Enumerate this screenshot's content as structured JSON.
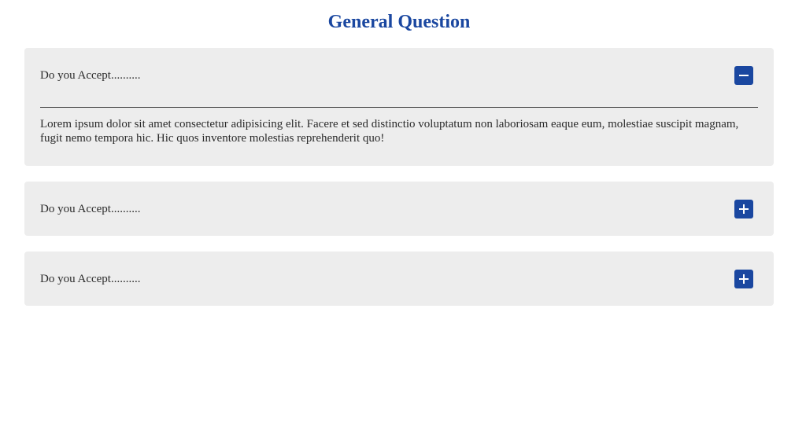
{
  "page": {
    "title": "General Question"
  },
  "colors": {
    "accent": "#1a47a0",
    "card_bg": "#ededed",
    "text": "#2b2b2b"
  },
  "faq": {
    "items": [
      {
        "question": "Do you Accept..........",
        "expanded": true,
        "toggle_icon": "minus-icon",
        "answer": "Lorem ipsum dolor sit amet consectetur adipisicing elit. Facere et sed distinctio voluptatum non laboriosam eaque eum, molestiae suscipit magnam, fugit nemo tempora hic. Hic quos inventore molestias reprehenderit quo!"
      },
      {
        "question": "Do you Accept..........",
        "expanded": false,
        "toggle_icon": "plus-icon"
      },
      {
        "question": "Do you Accept..........",
        "expanded": false,
        "toggle_icon": "plus-icon"
      }
    ]
  }
}
